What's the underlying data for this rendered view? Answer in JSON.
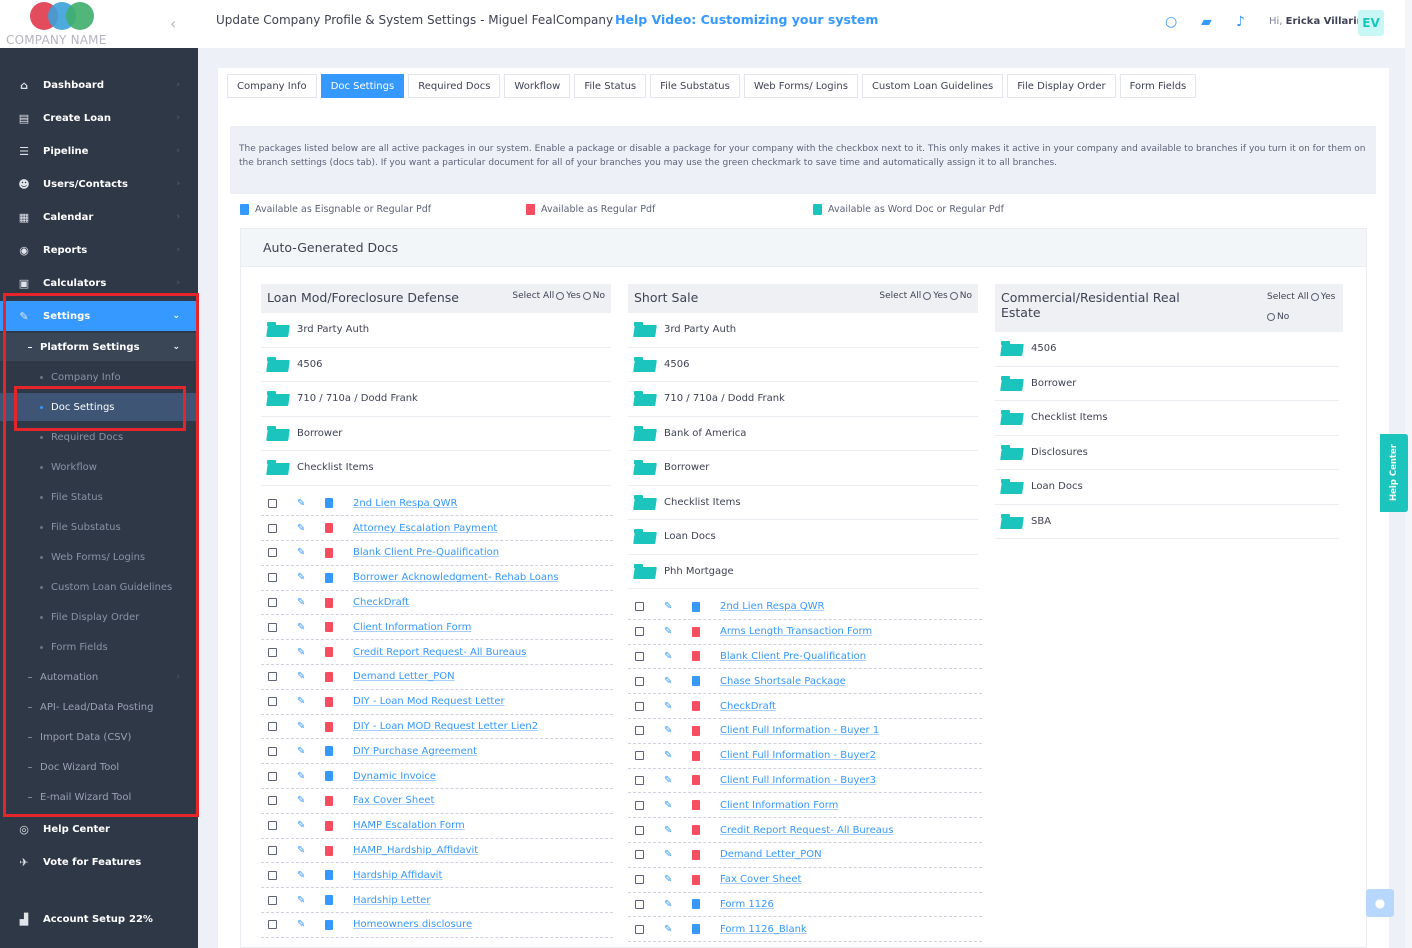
{
  "company": {
    "name": "COMPANY NAME"
  },
  "header": {
    "title": "Update Company Profile & System Settings - Miguel FealCompany",
    "help_link": "Help Video: Customizing your system",
    "greeting": "Hi,",
    "user_name": "Ericka Villarin",
    "avatar_initials": "EV"
  },
  "sidebar": {
    "items": [
      {
        "label": "Dashboard",
        "icon": "home-icon"
      },
      {
        "label": "Create Loan",
        "icon": "file-icon"
      },
      {
        "label": "Pipeline",
        "icon": "list-icon"
      },
      {
        "label": "Users/Contacts",
        "icon": "users-icon"
      },
      {
        "label": "Calendar",
        "icon": "calendar-icon"
      },
      {
        "label": "Reports",
        "icon": "reports-icon"
      },
      {
        "label": "Calculators",
        "icon": "calculator-icon"
      },
      {
        "label": "Settings",
        "icon": "wrench-icon"
      }
    ],
    "platform_settings": "Platform Settings",
    "sub_items": [
      "Company Info",
      "Doc Settings",
      "Required Docs",
      "Workflow",
      "File Status",
      "File Substatus",
      "Web Forms/ Logins",
      "Custom Loan Guidelines",
      "File Display Order",
      "Form Fields"
    ],
    "more_items": [
      "Automation",
      "API- Lead/Data Posting",
      "Import Data (CSV)",
      "Doc Wizard Tool",
      "E-mail Wizard Tool"
    ],
    "help_center": "Help Center",
    "vote": "Vote for Features",
    "account_setup": "Account Setup",
    "account_setup_pct": "22%"
  },
  "tabs": [
    "Company Info",
    "Doc Settings",
    "Required Docs",
    "Workflow",
    "File Status",
    "File Substatus",
    "Web Forms/ Logins",
    "Custom Loan Guidelines",
    "File Display Order",
    "Form Fields"
  ],
  "info_text": "The packages listed below are all active packages in our system. Enable a package or disable a package for your company with the checkbox next to it. This only makes it active in your company and available to branches if you turn it on for them on the branch settings (docs tab). If you want a particular document for all of your branches you may use the green checkmark to save time and automatically assign it to all branches.",
  "legend": {
    "esign": "Available as Eisgnable or Regular Pdf",
    "pdf": "Available as Regular Pdf",
    "word": "Available as Word Doc or Regular Pdf"
  },
  "section_title": "Auto-Generated Docs",
  "select_all": {
    "label": "Select All",
    "yes": "Yes",
    "no": "No"
  },
  "columns": [
    {
      "title": "Loan Mod/Foreclosure Defense",
      "folders": [
        "3rd Party Auth",
        "4506",
        "710 / 710a / Dodd Frank",
        "Borrower",
        "Checklist Items"
      ],
      "docs": [
        {
          "name": "2nd Lien Respa QWR",
          "type": "blue"
        },
        {
          "name": "Attorney Escalation Payment",
          "type": "red"
        },
        {
          "name": "Blank Client Pre-Qualification",
          "type": "red"
        },
        {
          "name": "Borrower Acknowledgment- Rehab Loans",
          "type": "blue"
        },
        {
          "name": "CheckDraft",
          "type": "red"
        },
        {
          "name": "Client Information Form",
          "type": "red"
        },
        {
          "name": "Credit Report Request- All Bureaus",
          "type": "red"
        },
        {
          "name": "Demand Letter_PON",
          "type": "red"
        },
        {
          "name": "DIY - Loan Mod Request Letter",
          "type": "red"
        },
        {
          "name": "DIY - Loan MOD Request Letter Lien2",
          "type": "red"
        },
        {
          "name": "DIY Purchase Agreement",
          "type": "blue"
        },
        {
          "name": "Dynamic Invoice",
          "type": "blue"
        },
        {
          "name": "Fax Cover Sheet",
          "type": "red"
        },
        {
          "name": "HAMP Escalation Form",
          "type": "red"
        },
        {
          "name": "HAMP_Hardship_Affidavit",
          "type": "red"
        },
        {
          "name": "Hardship Affidavit",
          "type": "blue"
        },
        {
          "name": "Hardship Letter",
          "type": "blue"
        },
        {
          "name": "Homeowners disclosure",
          "type": "blue"
        }
      ]
    },
    {
      "title": "Short Sale",
      "folders": [
        "3rd Party Auth",
        "4506",
        "710 / 710a / Dodd Frank",
        "Bank of America",
        "Borrower",
        "Checklist Items",
        "Loan Docs",
        "Phh Mortgage"
      ],
      "docs": [
        {
          "name": "2nd Lien Respa QWR",
          "type": "blue"
        },
        {
          "name": "Arms Length Transaction Form",
          "type": "red"
        },
        {
          "name": "Blank Client Pre-Qualification",
          "type": "red"
        },
        {
          "name": "Chase Shortsale Package",
          "type": "blue"
        },
        {
          "name": "CheckDraft",
          "type": "red"
        },
        {
          "name": "Client Full Information - Buyer 1",
          "type": "red"
        },
        {
          "name": "Client Full Information - Buyer2",
          "type": "red"
        },
        {
          "name": "Client Full Information - Buyer3",
          "type": "red"
        },
        {
          "name": "Client Information Form",
          "type": "red"
        },
        {
          "name": "Credit Report Request- All Bureaus",
          "type": "red"
        },
        {
          "name": "Demand Letter_PON",
          "type": "red"
        },
        {
          "name": "Fax Cover Sheet",
          "type": "red"
        },
        {
          "name": "Form 1126",
          "type": "blue"
        },
        {
          "name": "Form 1126_Blank",
          "type": "blue"
        }
      ]
    },
    {
      "title": "Commercial/Residential Real Estate",
      "folders": [
        "4506",
        "Borrower",
        "Checklist Items",
        "Disclosures",
        "Loan Docs",
        "SBA"
      ],
      "docs": []
    }
  ],
  "help_center_tab": "Help Center",
  "colors": {
    "accent": "#3699ff",
    "sidebar_bg": "#2f3846",
    "folder": "#1bc5bd",
    "pdf_red": "#f64e60",
    "highlight": "#e5252a"
  }
}
